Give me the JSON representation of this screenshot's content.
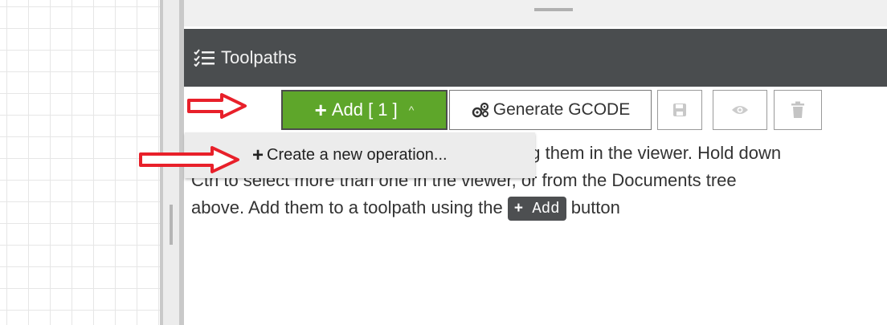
{
  "panel": {
    "title": "Toolpaths"
  },
  "toolbar": {
    "add_label": "Add [ 1 ]",
    "add_caret": "^",
    "generate_label": "Generate GCODE",
    "plus_glyph": "+"
  },
  "dropdown": {
    "create_operation": "Create a new operation..."
  },
  "body": {
    "line1": "ng them in the viewer. Hold down",
    "line2": "Ctrl to select more than one in the viewer, or from the Documents tree",
    "line3_before": "above. Add them to a toolpath using the",
    "inline_button": "Add",
    "line3_after": "button"
  },
  "icons": {
    "panel": "checklist-icon",
    "add": "plus-icon",
    "generate": "gears-icon",
    "save": "save-icon",
    "view": "eye-icon",
    "delete": "trash-icon",
    "annotation": "red-arrow-icon"
  },
  "colors": {
    "header_bg": "#4a4d4f",
    "add_button": "#5ea62a",
    "arrow": "#e8202a",
    "dropdown_bg": "#ececec"
  }
}
